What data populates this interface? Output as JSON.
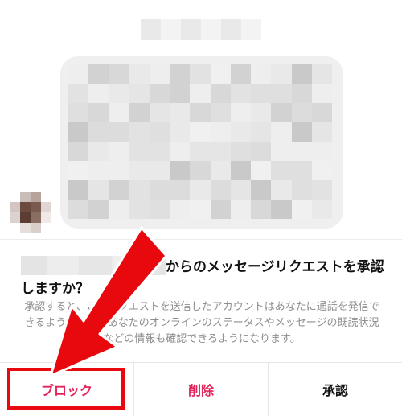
{
  "request": {
    "question_suffix": "からのメッセージリクエストを承認しますか？",
    "description": "承認すると、このリクエストを送信したアカウントはあなたに通話を発信できるようになり、あなたのオンラインのステータスやメッセージの既読状況などの情報も確認できるようになります。"
  },
  "actions": {
    "block_label": "ブロック",
    "delete_label": "削除",
    "accept_label": "承認"
  },
  "colors": {
    "destructive": "#e3245a",
    "annotation_red": "#e8090f"
  }
}
